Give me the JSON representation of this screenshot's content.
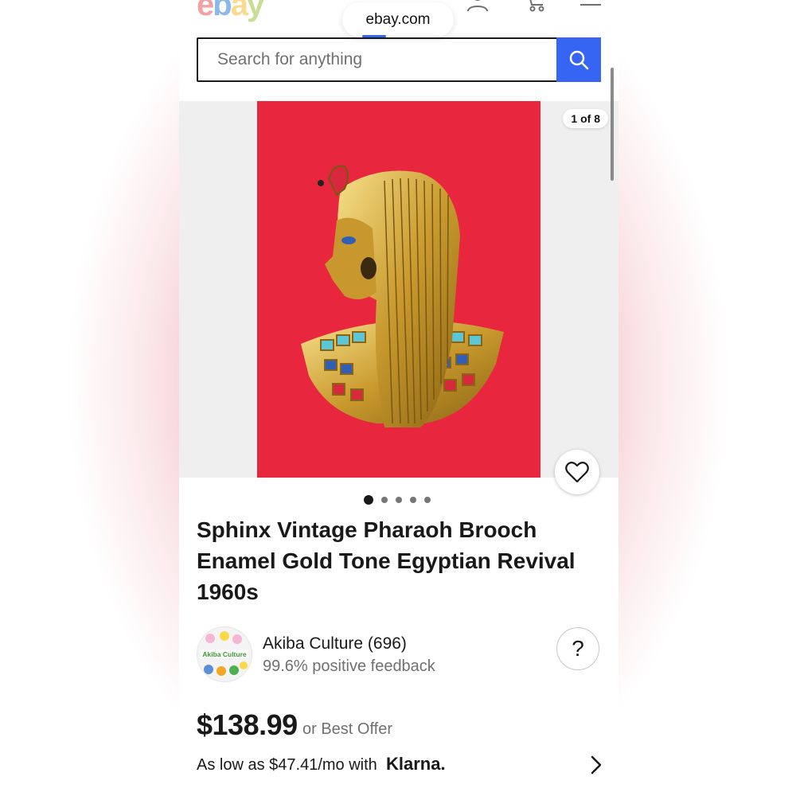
{
  "header": {
    "logo_text": "ebay",
    "url": "ebay.com",
    "icons": [
      "account-icon",
      "cart-icon",
      "menu-icon"
    ]
  },
  "search": {
    "placeholder": "Search for anything",
    "button_icon": "search-icon"
  },
  "gallery": {
    "counter": "1 of 8",
    "current_page": 1,
    "total_pages": 5,
    "favorite_icon": "heart-icon",
    "photo_bg": "#e8273f"
  },
  "product": {
    "title": "Sphinx Vintage Pharaoh Brooch Enamel Gold Tone Egyptian Revival 1960s"
  },
  "seller": {
    "name": "Akiba Culture (696)",
    "feedback": "99.6% positive feedback",
    "avatar_text": "Akiba Culture"
  },
  "help": {
    "label": "?"
  },
  "pricing": {
    "price": "$138.99",
    "best_offer": "or Best Offer",
    "financing": "As low as $47.41/mo with",
    "financing_brand": "Klarna."
  },
  "colors": {
    "accent": "#3665f3",
    "text": "#191919",
    "muted": "#707070"
  }
}
